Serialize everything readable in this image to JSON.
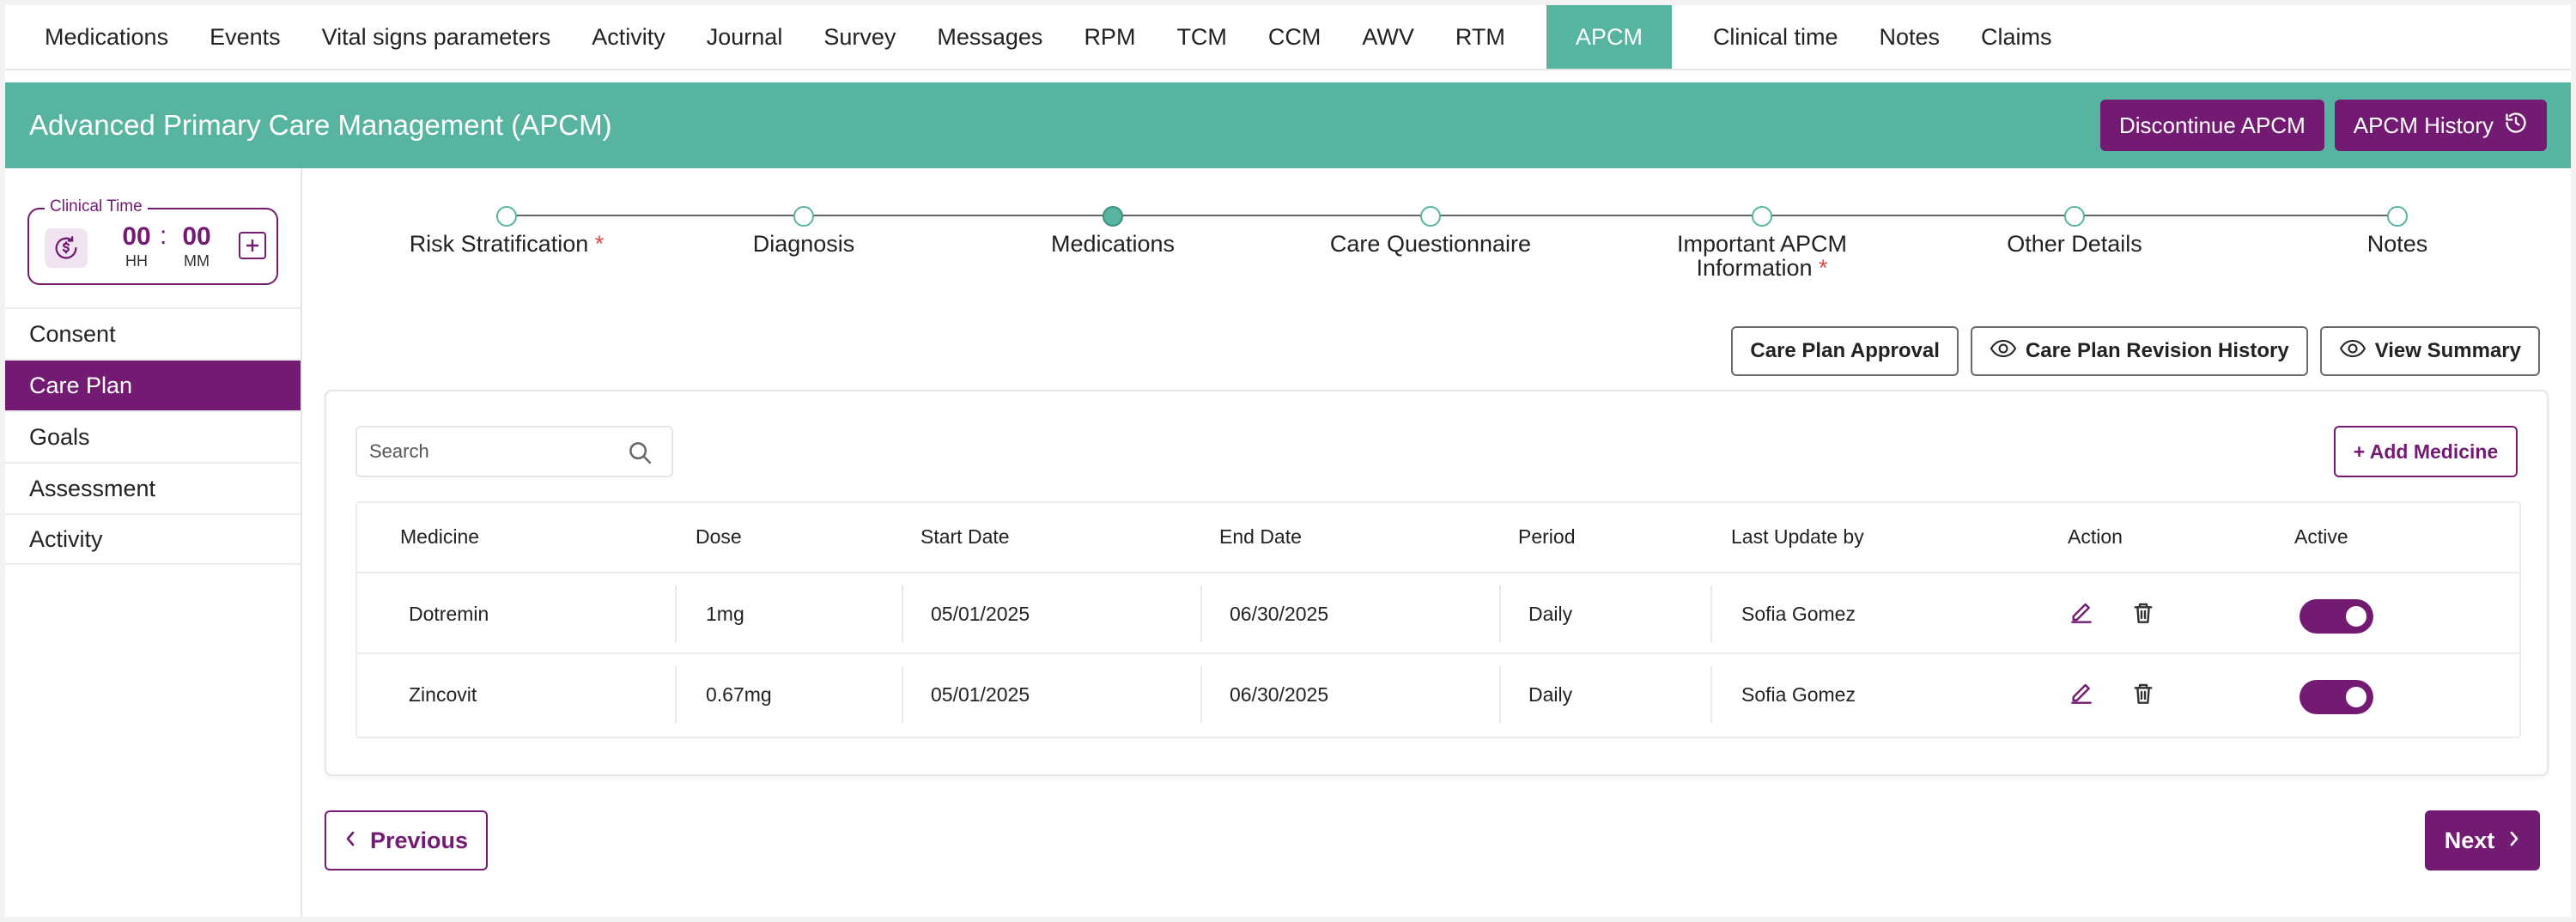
{
  "nav": {
    "tabs": [
      "Medications",
      "Events",
      "Vital signs parameters",
      "Activity",
      "Journal",
      "Survey",
      "Messages",
      "RPM",
      "TCM",
      "CCM",
      "AWV",
      "RTM",
      "APCM",
      "Clinical time",
      "Notes",
      "Claims"
    ],
    "active": "APCM"
  },
  "header": {
    "title": "Advanced Primary Care Management (APCM)",
    "discontinue_label": "Discontinue APCM",
    "history_label": "APCM History"
  },
  "clinical_time": {
    "legend": "Clinical Time",
    "hours": "00",
    "minutes": "00",
    "hours_unit": "HH",
    "minutes_unit": "MM",
    "separator": ":"
  },
  "sidebar": {
    "items": [
      "Consent",
      "Care Plan",
      "Goals",
      "Assessment",
      "Activity"
    ],
    "active": "Care Plan"
  },
  "stepper": {
    "steps": [
      {
        "line1": "Risk Stratification",
        "line2": "",
        "required": true
      },
      {
        "line1": "Diagnosis",
        "line2": "",
        "required": false
      },
      {
        "line1": "Medications",
        "line2": "",
        "required": false
      },
      {
        "line1": "Care Questionnaire",
        "line2": "",
        "required": false
      },
      {
        "line1": "Important APCM",
        "line2": "Information",
        "required": true
      },
      {
        "line1": "Other Details",
        "line2": "",
        "required": false
      },
      {
        "line1": "Notes",
        "line2": "",
        "required": false
      }
    ],
    "active_step": 2,
    "required_marker": "*"
  },
  "actions": {
    "approval_label": "Care Plan Approval",
    "revision_label": "Care Plan Revision History",
    "summary_label": "View Summary"
  },
  "medicines": {
    "search_placeholder": "Search",
    "add_label": "+ Add Medicine",
    "columns": [
      "Medicine",
      "Dose",
      "Start Date",
      "End Date",
      "Period",
      "Last Update by",
      "Action",
      "Active"
    ],
    "rows": [
      {
        "medicine": "Dotremin",
        "dose": "1mg",
        "start": "05/01/2025",
        "end": "06/30/2025",
        "period": "Daily",
        "updated_by": "Sofia Gomez",
        "active": true
      },
      {
        "medicine": "Zincovit",
        "dose": "0.67mg",
        "start": "05/01/2025",
        "end": "06/30/2025",
        "period": "Daily",
        "updated_by": "Sofia Gomez",
        "active": true
      }
    ]
  },
  "footer": {
    "previous_label": "Previous",
    "next_label": "Next"
  },
  "colors": {
    "teal": "#56b4a0",
    "purple": "#731b72",
    "required": "#e04848"
  }
}
